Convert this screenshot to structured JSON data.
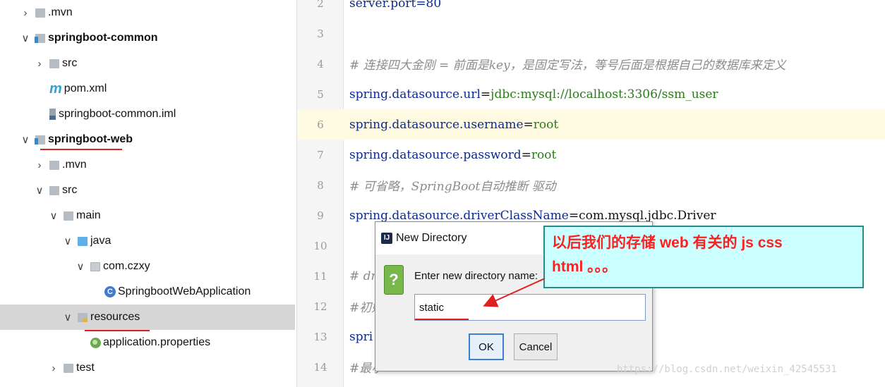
{
  "tree": {
    "rows": [
      {
        "label": ".mvn",
        "arrow": "›",
        "icon": "folder-icon",
        "indent": 28
      },
      {
        "label": "springboot-common",
        "arrow": "∨",
        "icon": "module-folder-icon",
        "indent": 28,
        "bold": true
      },
      {
        "label": "src",
        "arrow": "›",
        "icon": "folder-icon",
        "indent": 48
      },
      {
        "label": "pom.xml",
        "arrow": "",
        "icon": "maven-icon",
        "indent": 48
      },
      {
        "label": "springboot-common.iml",
        "arrow": "",
        "icon": "iml-file-icon",
        "indent": 48
      },
      {
        "label": "springboot-web",
        "arrow": "∨",
        "icon": "module-folder-icon",
        "indent": 28,
        "bold": true
      },
      {
        "label": ".mvn",
        "arrow": "›",
        "icon": "folder-icon",
        "indent": 48
      },
      {
        "label": "src",
        "arrow": "∨",
        "icon": "folder-icon",
        "indent": 48
      },
      {
        "label": "main",
        "arrow": "∨",
        "icon": "folder-icon",
        "indent": 68
      },
      {
        "label": "java",
        "arrow": "∨",
        "icon": "source-folder-icon",
        "indent": 88
      },
      {
        "label": "com.czxy",
        "arrow": "∨",
        "icon": "package-icon",
        "indent": 106
      },
      {
        "label": "SpringbootWebApplication",
        "arrow": "",
        "icon": "spring-class-icon",
        "indent": 126
      },
      {
        "label": "resources",
        "arrow": "∨",
        "icon": "resources-folder-icon",
        "indent": 88,
        "selected": true
      },
      {
        "label": "application.properties",
        "arrow": "",
        "icon": "properties-file-icon",
        "indent": 106
      },
      {
        "label": "test",
        "arrow": "›",
        "icon": "folder-icon",
        "indent": 68
      }
    ]
  },
  "editor": {
    "lines": [
      {
        "num": "2",
        "parts": [
          {
            "t": "server.port=80",
            "k": "c-key"
          }
        ]
      },
      {
        "num": "3",
        "parts": []
      },
      {
        "num": "4",
        "parts": [
          {
            "t": "# 连接四大金刚 = 前面是key，是固定写法，等号后面是根据自己的数据库来定义",
            "k": "c-cm"
          }
        ]
      },
      {
        "num": "5",
        "parts": [
          {
            "t": "spring.datasource.url",
            "k": "c-key"
          },
          {
            "t": "=",
            "k": "c-eq"
          },
          {
            "t": "jdbc:mysql://localhost:3306/ssm_user",
            "k": "c-val"
          }
        ]
      },
      {
        "num": "6",
        "current": true,
        "parts": [
          {
            "t": "spring.datasource.username",
            "k": "c-key"
          },
          {
            "t": "=",
            "k": "c-eq"
          },
          {
            "t": "root",
            "k": "c-val"
          }
        ]
      },
      {
        "num": "7",
        "parts": [
          {
            "t": "spring.datasource.password",
            "k": "c-key"
          },
          {
            "t": "=",
            "k": "c-eq"
          },
          {
            "t": "root",
            "k": "c-val"
          }
        ]
      },
      {
        "num": "8",
        "parts": [
          {
            "t": "# 可省略，SpringBoot自动推断 驱动",
            "k": "c-cm"
          }
        ]
      },
      {
        "num": "9",
        "parts": [
          {
            "t": "spring.datasource.driverClassName",
            "k": "c-key"
          },
          {
            "t": "=",
            "k": "c-eq"
          },
          {
            "t": "com.mysql.jdbc.Driver",
            "k": "c-eq"
          }
        ]
      },
      {
        "num": "10",
        "parts": []
      },
      {
        "num": "11",
        "parts": [
          {
            "t": "# dru",
            "k": "c-cm"
          }
        ]
      },
      {
        "num": "12",
        "parts": [
          {
            "t": "#初始",
            "k": "c-cm"
          }
        ]
      },
      {
        "num": "13",
        "parts": [
          {
            "t": "spri",
            "k": "c-key"
          }
        ]
      },
      {
        "num": "14",
        "parts": [
          {
            "t": "#最小",
            "k": "c-cm"
          }
        ]
      }
    ]
  },
  "dialog": {
    "title": "New Directory",
    "prompt": "Enter new directory name:",
    "input_value": "static",
    "ok_label": "OK",
    "cancel_label": "Cancel"
  },
  "annotation": {
    "line1": "以后我们的存储 web 有关的 js css",
    "line2": "html 。。。"
  },
  "watermark": "https://blog.csdn.net/weixin_42545531",
  "colors": {
    "accent_red": "#e02020",
    "callout_bg": "#ccffff",
    "key_blue": "#0b2a8f",
    "value_green": "#2b7a1a",
    "selection_gray": "#d6d6d6"
  }
}
